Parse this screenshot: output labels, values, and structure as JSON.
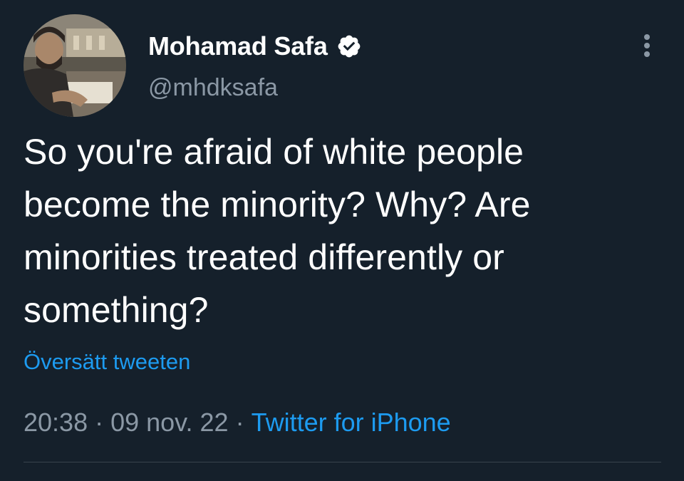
{
  "tweet": {
    "author": {
      "display_name": "Mohamad Safa",
      "handle": "@mhdksafa",
      "verified": true,
      "avatar_icon": "profile-photo"
    },
    "text": "So you're afraid of white people become the minority? Why? Are minorities treated differently or something?",
    "translate_label": "Översätt tweeten",
    "time": "20:38",
    "separator": "·",
    "date": "09 nov. 22",
    "source": "Twitter for iPhone",
    "more_icon": "more-options-icon"
  },
  "colors": {
    "background": "#15202b",
    "text_primary": "#ffffff",
    "text_secondary": "#8b98a5",
    "accent": "#1d9bf0",
    "divider": "#38444d"
  }
}
